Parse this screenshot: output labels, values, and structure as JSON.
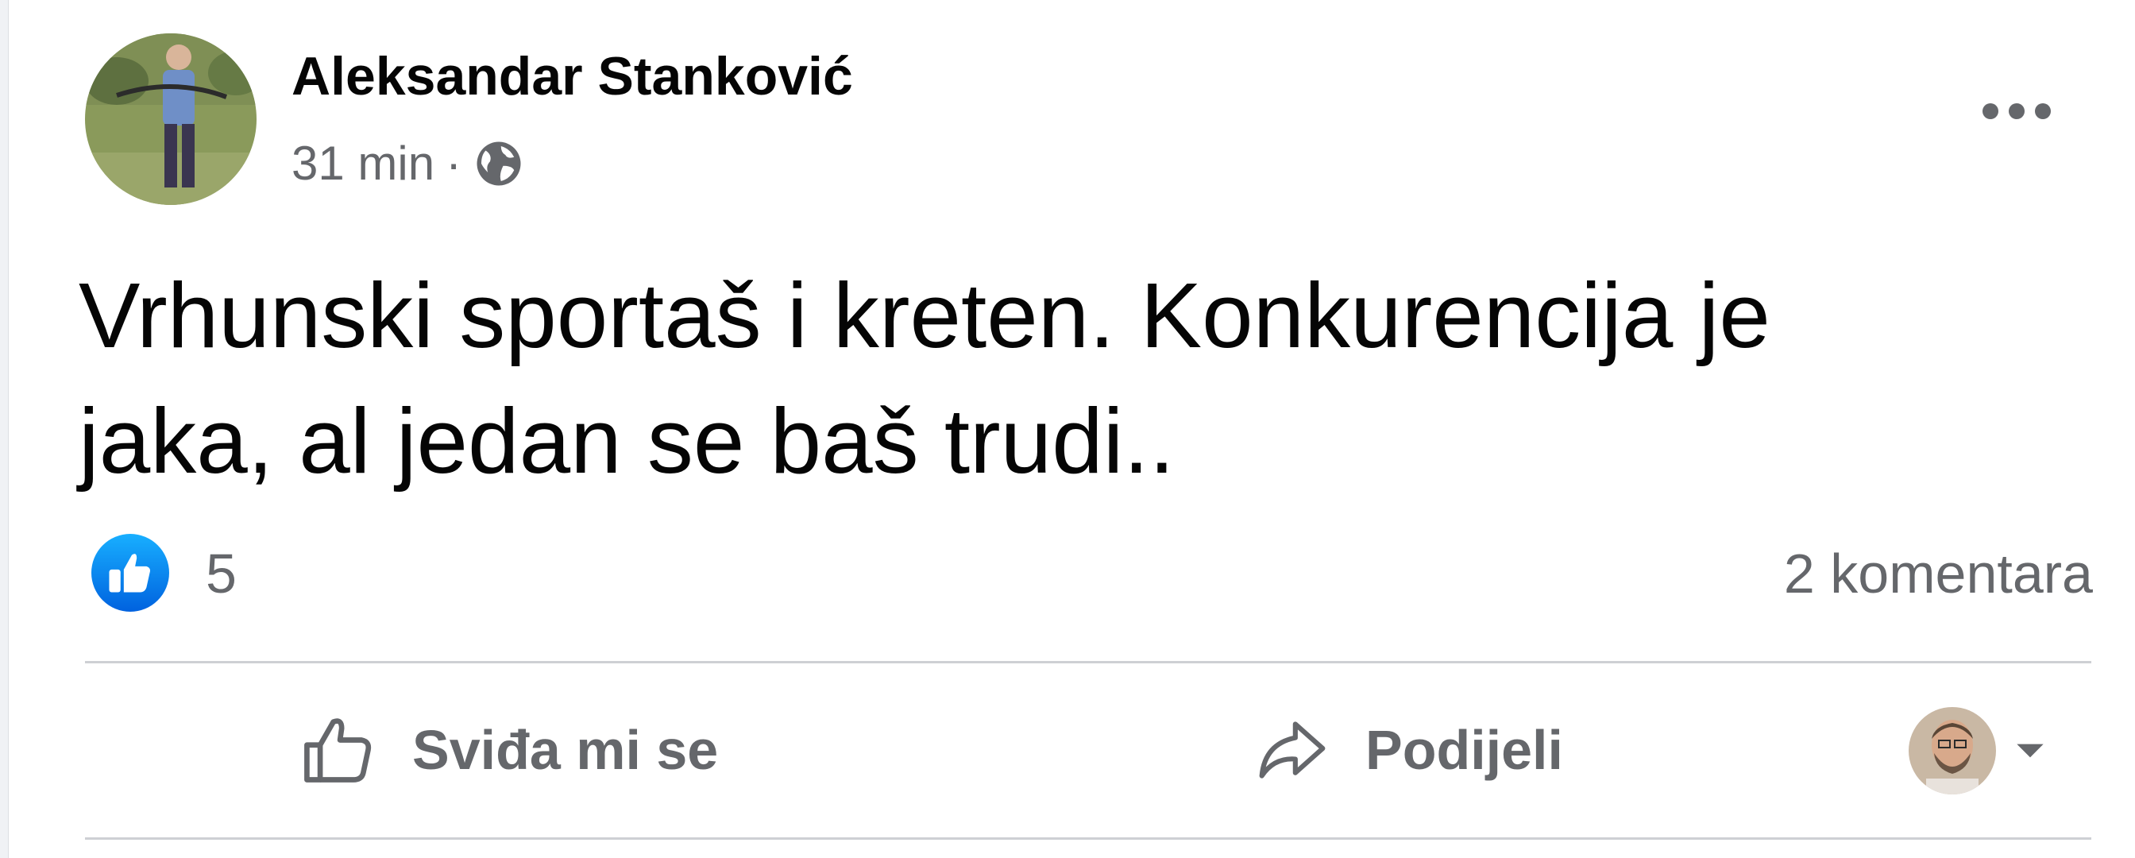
{
  "post": {
    "author": "Aleksandar Stanković",
    "time": "31 min",
    "separator": "·",
    "audience_icon": "globe-icon",
    "text": "Vrhunski sportaš i kreten. Konkurencija je\njaka, al jedan se baš trudi..",
    "more_icon": "more-options-icon"
  },
  "reactions": {
    "icon": "like-badge-icon",
    "count": "5",
    "comments": "2 komentara"
  },
  "actions": {
    "like_label": "Sviđa mi se",
    "share_label": "Podijeli",
    "like_icon": "thumbs-up-icon",
    "share_icon": "share-arrow-icon",
    "audience_dropdown_icon": "caret-down-icon"
  },
  "colors": {
    "like_blue": "#1877f2",
    "text_primary": "#050505",
    "text_secondary": "#65676b"
  }
}
